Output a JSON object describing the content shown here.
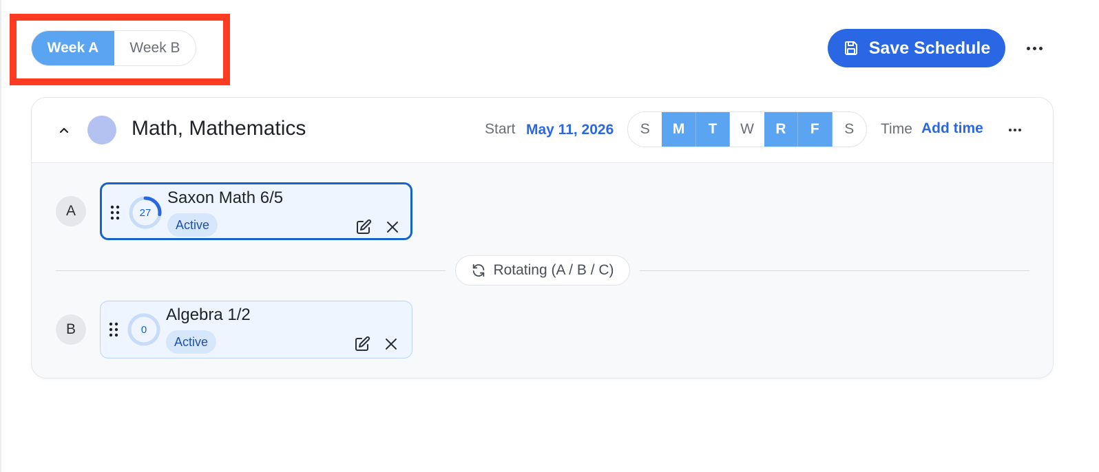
{
  "week_toggle": {
    "options": [
      "Week A",
      "Week B"
    ],
    "selected": "Week A"
  },
  "toolbar": {
    "save_label": "Save Schedule"
  },
  "subject": {
    "title": "Math, Mathematics",
    "color": "#b3c2f0",
    "start_label": "Start",
    "start_date": "May 11, 2026",
    "days": [
      {
        "label": "S",
        "on": false
      },
      {
        "label": "M",
        "on": true
      },
      {
        "label": "T",
        "on": true
      },
      {
        "label": "W",
        "on": false
      },
      {
        "label": "R",
        "on": true
      },
      {
        "label": "F",
        "on": true
      },
      {
        "label": "S",
        "on": false
      }
    ],
    "time_label": "Time",
    "add_time_label": "Add time"
  },
  "slots": [
    {
      "slot": "A",
      "course": "Saxon Math 6/5",
      "progress": "27",
      "progress_fraction": 0.27,
      "status": "Active",
      "selected": true
    },
    {
      "slot": "B",
      "course": "Algebra 1/2",
      "progress": "0",
      "progress_fraction": 0,
      "status": "Active",
      "selected": false
    }
  ],
  "rotation": {
    "label": "Rotating (A / B / C)"
  },
  "colors": {
    "accent": "#2a67e4",
    "day_active": "#5ba4f2",
    "highlight": "#ff3b21"
  }
}
